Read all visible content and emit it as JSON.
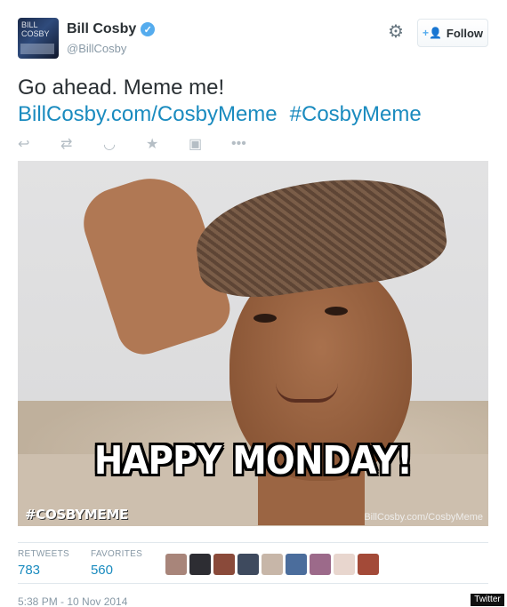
{
  "tweet": {
    "author": {
      "display_name": "Bill Cosby",
      "handle": "@BillCosby",
      "verified": true,
      "avatar_text": "BILL COSBY"
    },
    "header": {
      "settings_icon": "gear-icon",
      "follow_label": "Follow",
      "follow_icon": "add-user-icon"
    },
    "text_line1": "Go ahead. Meme me!",
    "link": "BillCosby.com/CosbyMeme",
    "hashtag": "#CosbyMeme",
    "actions": [
      {
        "name": "reply-icon",
        "glyph": "↩"
      },
      {
        "name": "retweet-icon",
        "glyph": "⇄"
      },
      {
        "name": "save-icon",
        "glyph": "◡"
      },
      {
        "name": "favorite-icon",
        "glyph": "★"
      },
      {
        "name": "photo-icon",
        "glyph": "▣"
      },
      {
        "name": "more-icon",
        "glyph": "•••"
      }
    ],
    "media": {
      "caption": "HAPPY MONDAY!",
      "hashtag_stamp": "#COSBYMEME",
      "url_stamp": "BillCosby.com/CosbyMeme"
    },
    "stats": {
      "retweets_label": "RETWEETS",
      "retweets_value": "783",
      "favorites_label": "FAVORITES",
      "favorites_value": "560"
    },
    "favoriter_colors": [
      "#a8857a",
      "#2d2d33",
      "#8a4a3a",
      "#3e4a5e",
      "#c7b6a8",
      "#4b6d9c",
      "#9c6a8a",
      "#e8d6ce",
      "#a34a38"
    ],
    "timestamp": "5:38 PM - 10 Nov 2014",
    "watermark": "Twitter"
  },
  "colors": {
    "link": "#1a8bbf",
    "verified": "#55acee",
    "muted": "#8899a6"
  }
}
